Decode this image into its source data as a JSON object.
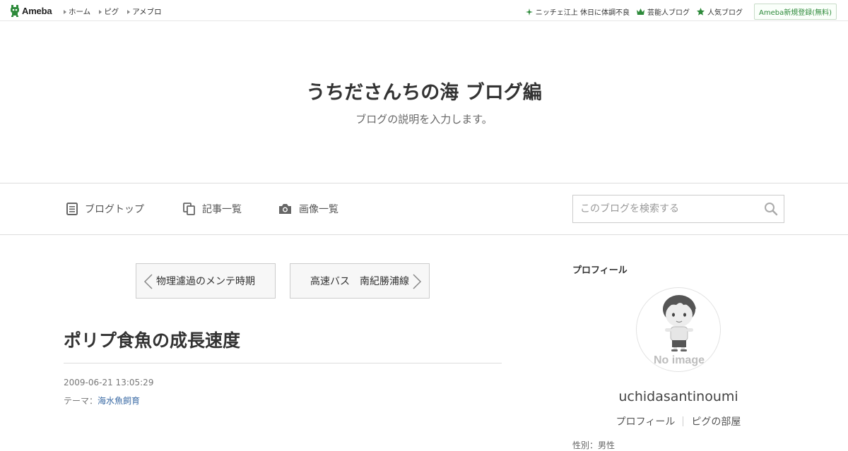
{
  "topbar": {
    "logo_text": "Ameba",
    "nav": [
      "ホーム",
      "ピグ",
      "アメブロ"
    ],
    "right_links": [
      {
        "label": "ニッチェ江上 休日に体調不良",
        "icon": "sparkle-icon"
      },
      {
        "label": "芸能人ブログ",
        "icon": "crown-icon"
      },
      {
        "label": "人気ブログ",
        "icon": "star-icon"
      }
    ],
    "register_label": "Ameba新規登録(無料)"
  },
  "header": {
    "title": "うちださんちの海 ブログ編",
    "description": "ブログの説明を入力します。"
  },
  "navbar": {
    "items": [
      {
        "label": "ブログトップ",
        "icon": "document-icon"
      },
      {
        "label": "記事一覧",
        "icon": "copy-icon"
      },
      {
        "label": "画像一覧",
        "icon": "camera-icon"
      }
    ],
    "search_placeholder": "このブログを検索する"
  },
  "pager": {
    "prev_label": "物理濾過のメンテ時期",
    "next_label": "高速バス　南紀勝浦線"
  },
  "article": {
    "title": "ポリプ食魚の成長速度",
    "date": "2009-06-21 13:05:29",
    "theme_prefix": "テーマ：",
    "theme_link": "海水魚飼育"
  },
  "sidebar": {
    "heading": "プロフィール",
    "avatar_caption": "No image",
    "name": "uchidasantinoumi",
    "links": [
      "プロフィール",
      "ピグの部屋"
    ],
    "cut_text": "性別：男性"
  },
  "colors": {
    "brand_green": "#2d8a3a",
    "link_blue": "#3b6ba5"
  }
}
